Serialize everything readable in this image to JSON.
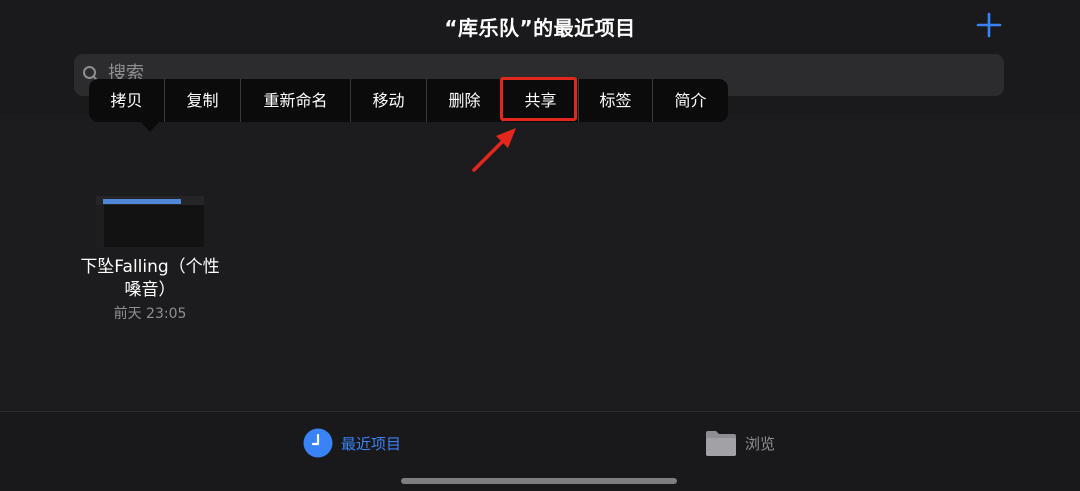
{
  "header": {
    "title": "“库乐队”的最近项目",
    "add_icon": "plus-icon"
  },
  "search": {
    "placeholder": "搜索",
    "icon": "search-icon"
  },
  "context_menu": {
    "items": [
      {
        "label": "拷贝"
      },
      {
        "label": "复制"
      },
      {
        "label": "重新命名"
      },
      {
        "label": "移动"
      },
      {
        "label": "删除"
      },
      {
        "label": "共享",
        "highlighted": true
      },
      {
        "label": "标签"
      },
      {
        "label": "简介"
      }
    ],
    "highlight_color": "#e3271c"
  },
  "file": {
    "name_line1": "下坠Falling（个性",
    "name_line2": "嗓音）",
    "date": "前天 23:05"
  },
  "tabbar": {
    "recent_label": "最近项目",
    "browse_label": "浏览",
    "recent_icon": "clock-icon",
    "browse_icon": "folder-icon",
    "active_color": "#3a82f7",
    "inactive_color": "#8e8e93"
  }
}
